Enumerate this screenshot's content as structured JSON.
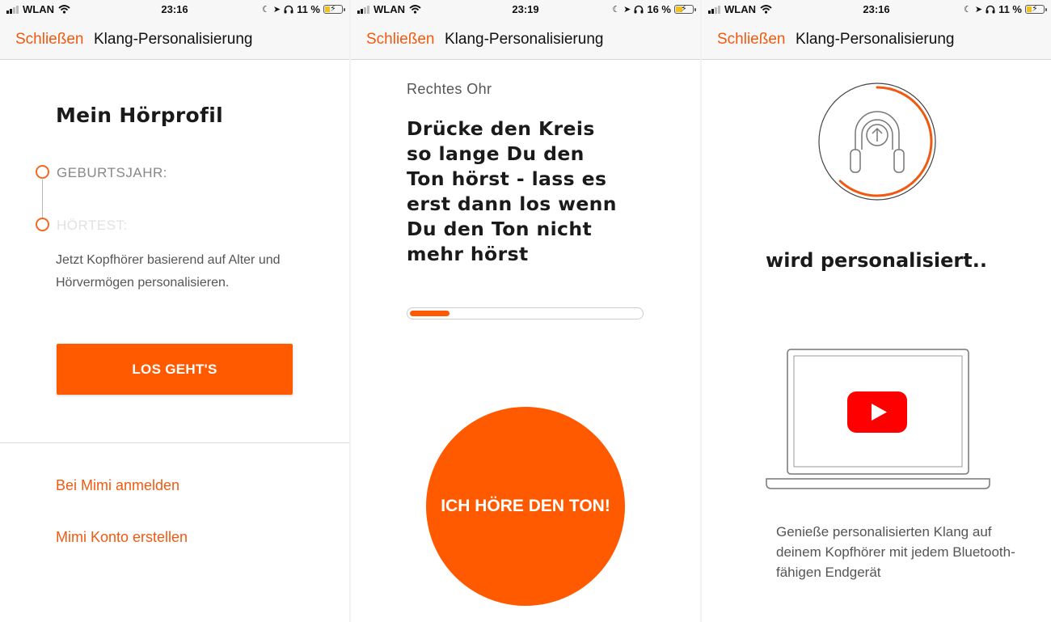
{
  "screens": [
    {
      "status": {
        "carrier": "WLAN",
        "time": "23:16",
        "battery": "11 %"
      },
      "nav": {
        "close": "Schließen",
        "title": "Klang-Personalisierung"
      },
      "heading": "Mein Hörprofil",
      "steps": [
        {
          "label": "GEBURTSJAHR:",
          "color": "#888888"
        },
        {
          "label": "HÖRTEST:",
          "color": "#e2e2e2"
        }
      ],
      "description": "Jetzt Kopfhörer basierend auf Alter und Hörvermögen personalisieren.",
      "cta": "LOS GEHT'S",
      "links": [
        "Bei Mimi anmelden",
        "Mimi Konto erstellen"
      ]
    },
    {
      "status": {
        "carrier": "WLAN",
        "time": "23:19",
        "battery": "16 %"
      },
      "nav": {
        "close": "Schließen",
        "title": "Klang-Personalisierung"
      },
      "ear": "Rechtes Ohr",
      "instruction": "Drücke den Kreis so lange Du den Ton hörst - lass es erst dann los wenn Du den Ton nicht mehr hörst",
      "progress": 0.17,
      "button": "ICH HÖRE DEN TON!"
    },
    {
      "status": {
        "carrier": "WLAN",
        "time": "23:16",
        "battery": "11 %"
      },
      "nav": {
        "close": "Schließen",
        "title": "Klang-Personalisierung"
      },
      "ring_progress": 0.62,
      "status_text": "wird personalisiert..",
      "description": "Genieße personalisierten Klang auf deinem Kopfhörer mit jedem Bluetooth-fähigen Endgerät"
    }
  ],
  "colors": {
    "accent": "#ff5a00",
    "link": "#f05a10",
    "youtube": "#ff0000"
  },
  "icons": [
    "signal-icon",
    "wifi-icon",
    "moon-icon",
    "location-arrow-icon",
    "headphones-icon",
    "battery-icon",
    "upload-icon",
    "youtube-play-icon",
    "laptop-icon"
  ]
}
